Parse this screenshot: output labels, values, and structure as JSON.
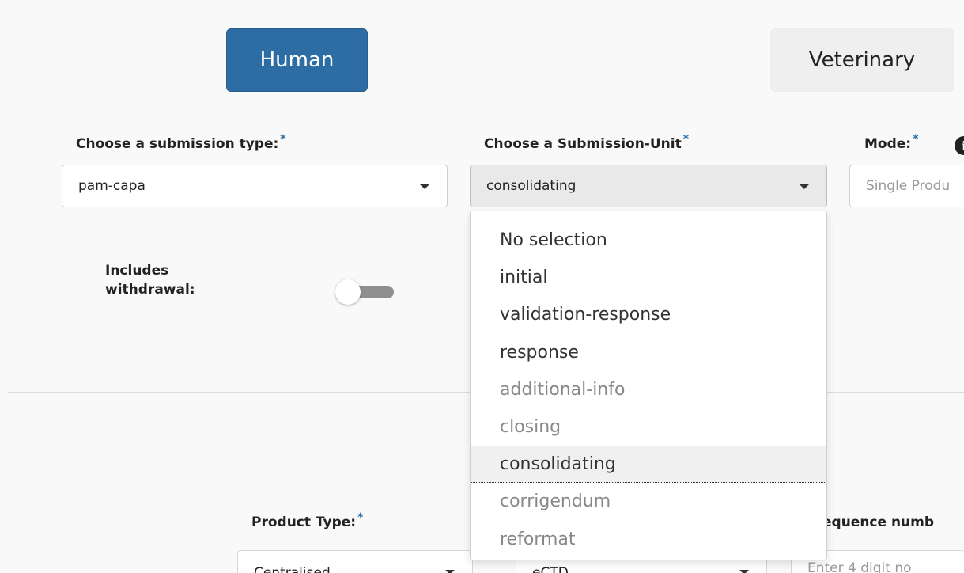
{
  "domains": {
    "human_label": "Human",
    "veterinary_label": "Veterinary"
  },
  "submission_type": {
    "label": "Choose a submission type:",
    "required_mark": "*",
    "value": "pam-capa"
  },
  "submission_unit": {
    "label": "Choose a Submission-Unit",
    "required_mark": "*",
    "value": "consolidating",
    "options": [
      {
        "label": "No selection",
        "enabled": true
      },
      {
        "label": "initial",
        "enabled": true
      },
      {
        "label": "validation-response",
        "enabled": true
      },
      {
        "label": "response",
        "enabled": true
      },
      {
        "label": "additional-info",
        "enabled": false
      },
      {
        "label": "closing",
        "enabled": false
      },
      {
        "label": "consolidating",
        "enabled": true,
        "selected": true
      },
      {
        "label": "corrigendum",
        "enabled": false
      },
      {
        "label": "reformat",
        "enabled": false
      }
    ]
  },
  "mode": {
    "label": "Mode:",
    "required_mark": "*",
    "placeholder": "Single Produ",
    "info_icon": "i"
  },
  "withdrawal": {
    "label_line1": "Includes",
    "label_line2": "withdrawal:",
    "on": false
  },
  "product_type": {
    "label": "Product Type:",
    "required_mark": "*",
    "value": "Centralised"
  },
  "format": {
    "value": "eCTD"
  },
  "sequence": {
    "label": "equence numb",
    "placeholder": "Enter 4 digit no"
  },
  "colors": {
    "primary": "#2e6da4",
    "secondary_button": "#efefef",
    "background": "#f9f9f9"
  }
}
